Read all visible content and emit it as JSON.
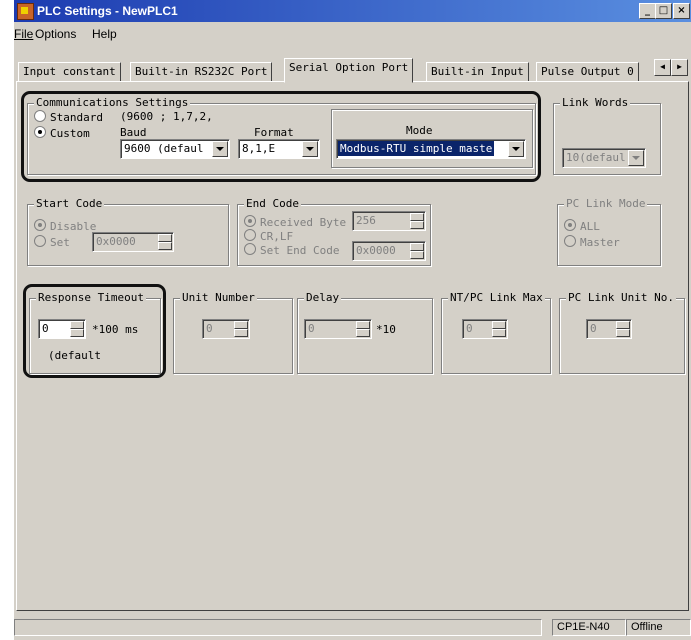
{
  "window": {
    "title": "PLC Settings - NewPLC1"
  },
  "title_buttons": {
    "minimize": "_",
    "maximize": "□",
    "close": "×"
  },
  "menu": {
    "file": "File",
    "options": "Options",
    "help": "Help"
  },
  "tabs": [
    "Input constant",
    "Built-in RS232C Port",
    "Serial Option Port",
    "Built-in Input",
    "Pulse Output 0"
  ],
  "tab_scroll": {
    "left": "◀",
    "right": "▶"
  },
  "communications": {
    "legend": "Communications Settings",
    "standard_label": "Standard",
    "standard_value": "(9600 ; 1,7,2,",
    "custom_label": "Custom",
    "standard_selected": false,
    "custom_selected": true,
    "baud_label": "Baud",
    "baud_value": "9600 (defaul",
    "format_label": "Format",
    "format_value": "8,1,E",
    "mode_label": "Mode",
    "mode_value": "Modbus-RTU simple maste"
  },
  "link_words": {
    "legend": "Link Words",
    "value": "10(defaul"
  },
  "start_code": {
    "legend": "Start Code",
    "disable_label": "Disable",
    "set_label": "Set",
    "set_value": "0x0000",
    "disable_selected": true
  },
  "end_code": {
    "legend": "End Code",
    "received_byte_label": "Received Byte",
    "received_byte_value": "256",
    "crlf_label": "CR,LF",
    "set_end_code_label": "Set End Code",
    "set_end_code_value": "0x0000",
    "received_byte_selected": true
  },
  "pc_link_mode": {
    "legend": "PC Link Mode",
    "all_label": "ALL",
    "master_label": "Master",
    "all_selected": true
  },
  "response_timeout": {
    "legend": "Response Timeout",
    "value": "0",
    "unit": "*100 ms",
    "note": "(default"
  },
  "unit_number": {
    "legend": "Unit Number",
    "value": "0"
  },
  "delay": {
    "legend": "Delay",
    "value": "0",
    "unit": "*10"
  },
  "nt_pc_link_max": {
    "legend": "NT/PC Link Max",
    "value": "0"
  },
  "pc_link_unit_no": {
    "legend": "PC Link Unit No.",
    "value": "0"
  },
  "status": {
    "model": "CP1E-N40",
    "state": "Offline"
  }
}
